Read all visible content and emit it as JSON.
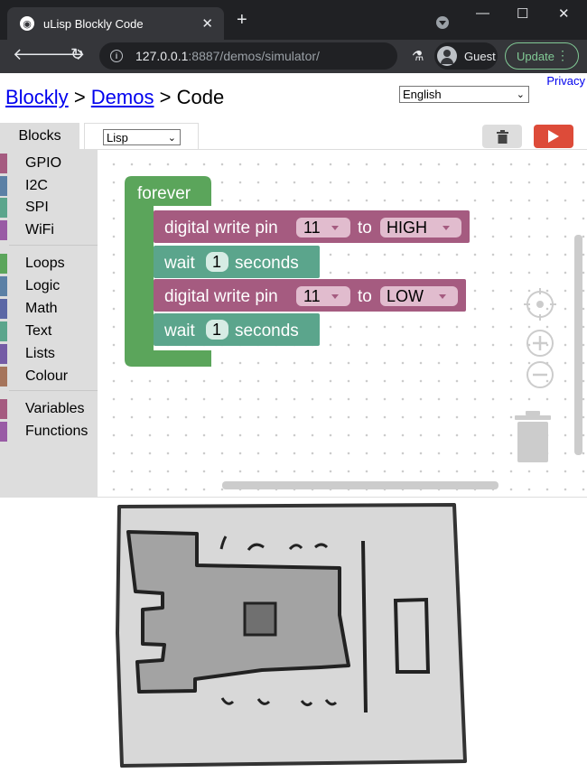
{
  "browser": {
    "tab_title": "uLisp Blockly Code",
    "tab_close": "✕",
    "new_tab": "+",
    "url_host": "127.0.0.1",
    "url_rest": ":8887/demos/simulator/",
    "profile": "Guest",
    "update_label": "Update",
    "window_controls": [
      "—",
      "☐",
      "✕"
    ]
  },
  "page": {
    "breadcrumb": {
      "link1": "Blockly",
      "sep1": ">",
      "link2": "Demos",
      "sep2": ">",
      "current": "Code"
    },
    "privacy": "Privacy",
    "language": "English",
    "tabs": {
      "blocks": "Blocks",
      "code_language": "Lisp"
    }
  },
  "toolbox": {
    "categories": [
      {
        "label": "GPIO",
        "color": "#a55b80"
      },
      {
        "label": "I2C",
        "color": "#5b80a5"
      },
      {
        "label": "SPI",
        "color": "#5ba58c"
      },
      {
        "label": "WiFi",
        "color": "#995ba5"
      },
      {
        "label": "Loops",
        "color": "#5ba55b"
      },
      {
        "label": "Logic",
        "color": "#5b80a5"
      },
      {
        "label": "Math",
        "color": "#5b67a5"
      },
      {
        "label": "Text",
        "color": "#5ba58c"
      },
      {
        "label": "Lists",
        "color": "#745ba5"
      },
      {
        "label": "Colour",
        "color": "#a5745b"
      },
      {
        "label": "Variables",
        "color": "#a55b80"
      },
      {
        "label": "Functions",
        "color": "#995ba5"
      }
    ]
  },
  "blocks": {
    "forever": "forever",
    "stmt1": {
      "label": "digital write pin",
      "pin": "11",
      "to": "to",
      "value": "HIGH"
    },
    "stmt2": {
      "label": "wait",
      "num": "1",
      "unit": "seconds"
    },
    "stmt3": {
      "label": "digital write pin",
      "pin": "11",
      "to": "to",
      "value": "LOW"
    },
    "stmt4": {
      "label": "wait",
      "num": "1",
      "unit": "seconds"
    },
    "colors": {
      "loop": "#5ba55b",
      "gpio": "#a55b80",
      "wait": "#5ba58c"
    }
  }
}
